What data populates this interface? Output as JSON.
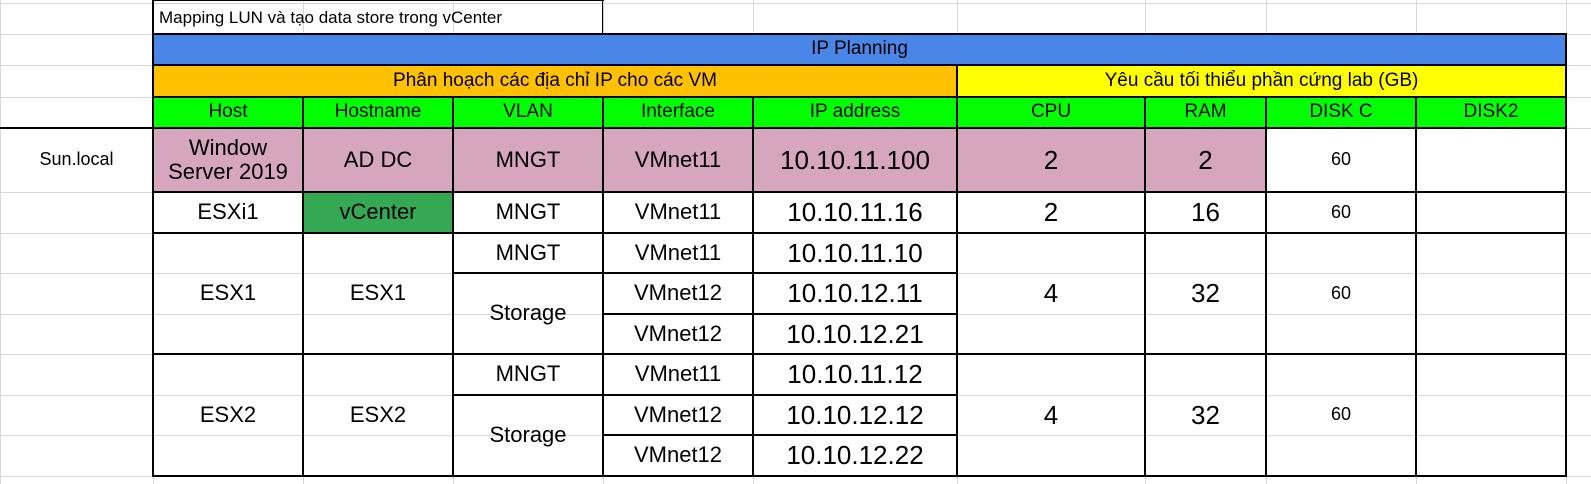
{
  "sheet": {
    "title": "Mapping LUN và tạo data store trong vCenter",
    "banner": "IP Planning",
    "group_ip": "Phân hoạch các địa chỉ IP cho các VM",
    "group_hw": "Yêu cầu tối thiểu phần cứng lab (GB)",
    "headers": [
      "Host",
      "Hostname",
      "VLAN",
      "Interface",
      "IP address",
      "CPU",
      "RAM",
      "DISK C",
      "DISK2"
    ],
    "label_row": "Sun.local",
    "rows": [
      {
        "host": "Window\nServer 2019",
        "hostname": "AD DC",
        "vlan": "MNGT",
        "interface": "VMnet11",
        "ip": "10.10.11.100",
        "cpu": "2",
        "ram": "2",
        "diskc": "60",
        "disk2": ""
      },
      {
        "host": "ESXi1",
        "hostname": "vCenter",
        "vlan": "MNGT",
        "interface": "VMnet11",
        "ip": "10.10.11.16",
        "cpu": "2",
        "ram": "16",
        "diskc": "60",
        "disk2": ""
      }
    ],
    "groups": [
      {
        "host": "ESX1",
        "hostname": "ESX1",
        "vlan_top": "MNGT",
        "vlan_bottom": "Storage",
        "interfaces": [
          "VMnet11",
          "VMnet12",
          "VMnet12"
        ],
        "ips": [
          "10.10.11.10",
          "10.10.12.11",
          "10.10.12.21"
        ],
        "cpu": "4",
        "ram": "32",
        "diskc": "60",
        "disk2": ""
      },
      {
        "host": "ESX2",
        "hostname": "ESX2",
        "vlan_top": "MNGT",
        "vlan_bottom": "Storage",
        "interfaces": [
          "VMnet11",
          "VMnet12",
          "VMnet12"
        ],
        "ips": [
          "10.10.11.12",
          "10.10.12.12",
          "10.10.12.22"
        ],
        "cpu": "4",
        "ram": "32",
        "diskc": "60",
        "disk2": ""
      }
    ]
  },
  "colors": {
    "banner_blue": "#4a86e8",
    "header_orange": "#ffc000",
    "header_yellow": "#ffff00",
    "header_green": "#00ff00",
    "row_pink": "#d5a6bd",
    "vcenter_green": "#34a853"
  }
}
